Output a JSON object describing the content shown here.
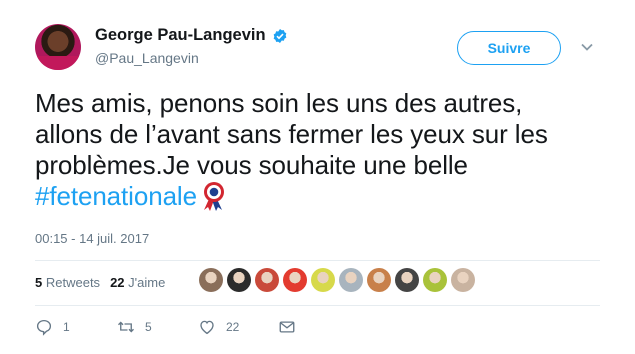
{
  "tweet": {
    "author_name": "George Pau-Langevin",
    "author_handle": "@Pau_Langevin",
    "follow_label": "Suivre",
    "text_line1": "Mes amis, penons soin les uns des autres,",
    "text_line2": "allons de l’avant sans fermer les yeux sur les",
    "text_line3": "problèmes.Je vous souhaite une belle",
    "hashtag": "#fetenationale",
    "timestamp": "00:15 - 14 juil. 2017"
  },
  "stats": {
    "retweets_count": "5",
    "retweets_label": "Retweets",
    "likes_count": "22",
    "likes_label": "J'aime"
  },
  "likers": [
    {
      "color": "#8a6e5a"
    },
    {
      "color": "#2b2b2b"
    },
    {
      "color": "#c94a3a"
    },
    {
      "color": "#e33b2f"
    },
    {
      "color": "#d7d94a"
    },
    {
      "color": "#a8b4be"
    },
    {
      "color": "#c8804a"
    },
    {
      "color": "#444444"
    },
    {
      "color": "#a9c23a"
    },
    {
      "color": "#c9b3a0"
    }
  ],
  "actions": {
    "reply_count": "1",
    "retweet_count": "5",
    "like_count": "22"
  },
  "colors": {
    "accent": "#1da1f2",
    "text": "#14171a",
    "muted": "#657786"
  }
}
